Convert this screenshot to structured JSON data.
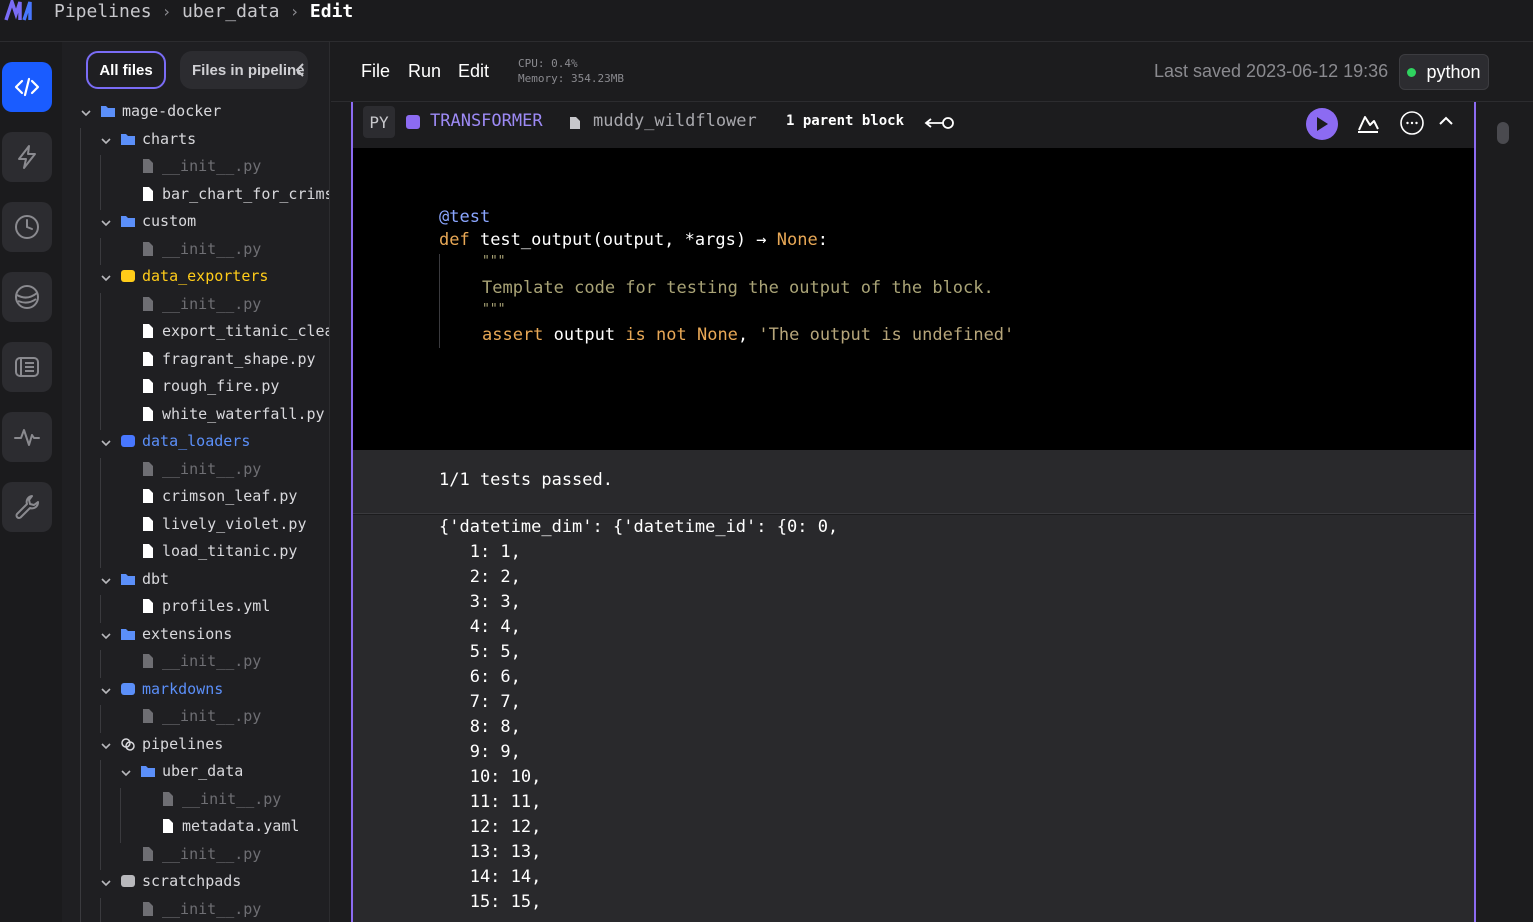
{
  "breadcrumb": {
    "root": "Pipelines",
    "pipeline": "uber_data",
    "current": "Edit"
  },
  "rail": {
    "items": [
      "code-icon",
      "trigger-icon",
      "history-icon",
      "terminal-icon",
      "files-icon",
      "monitor-icon",
      "settings-icon"
    ]
  },
  "browser": {
    "tab_all": "All files",
    "tab_pipeline": "Files in pipeline",
    "tree": [
      {
        "label": "mage-docker",
        "kind": "folder",
        "depth": 0
      },
      {
        "label": "charts",
        "kind": "folder",
        "depth": 1
      },
      {
        "label": "__init__.py",
        "kind": "file-dim",
        "depth": 2
      },
      {
        "label": "bar_chart_for_crimson",
        "kind": "file",
        "depth": 2
      },
      {
        "label": "custom",
        "kind": "folder",
        "depth": 1
      },
      {
        "label": "__init__.py",
        "kind": "file-dim",
        "depth": 2
      },
      {
        "label": "data_exporters",
        "kind": "exporter",
        "depth": 1
      },
      {
        "label": "__init__.py",
        "kind": "file-dim",
        "depth": 2
      },
      {
        "label": "export_titanic_clean",
        "kind": "file",
        "depth": 2
      },
      {
        "label": "fragrant_shape.py",
        "kind": "file",
        "depth": 2
      },
      {
        "label": "rough_fire.py",
        "kind": "file",
        "depth": 2
      },
      {
        "label": "white_waterfall.py",
        "kind": "file",
        "depth": 2
      },
      {
        "label": "data_loaders",
        "kind": "loader",
        "depth": 1
      },
      {
        "label": "__init__.py",
        "kind": "file-dim",
        "depth": 2
      },
      {
        "label": "crimson_leaf.py",
        "kind": "file",
        "depth": 2
      },
      {
        "label": "lively_violet.py",
        "kind": "file",
        "depth": 2
      },
      {
        "label": "load_titanic.py",
        "kind": "file",
        "depth": 2
      },
      {
        "label": "dbt",
        "kind": "folder",
        "depth": 1
      },
      {
        "label": "profiles.yml",
        "kind": "file",
        "depth": 2
      },
      {
        "label": "extensions",
        "kind": "folder",
        "depth": 1
      },
      {
        "label": "__init__.py",
        "kind": "file-dim",
        "depth": 2
      },
      {
        "label": "markdowns",
        "kind": "markdown",
        "depth": 1
      },
      {
        "label": "__init__.py",
        "kind": "file-dim",
        "depth": 2
      },
      {
        "label": "pipelines",
        "kind": "pipelines",
        "depth": 1
      },
      {
        "label": "uber_data",
        "kind": "folder",
        "depth": 2
      },
      {
        "label": "__init__.py",
        "kind": "file-dim",
        "depth": 3
      },
      {
        "label": "metadata.yaml",
        "kind": "file",
        "depth": 3
      },
      {
        "label": "__init__.py",
        "kind": "file-dim",
        "depth": 2
      },
      {
        "label": "scratchpads",
        "kind": "scratchpad",
        "depth": 1
      },
      {
        "label": "__init__.py",
        "kind": "file-dim",
        "depth": 2
      }
    ]
  },
  "toolbar": {
    "menu_file": "File",
    "menu_run": "Run",
    "menu_edit": "Edit",
    "cpu": "CPU: 0.4%",
    "memory": "Memory: 354.23MB",
    "saved": "Last saved 2023-06-12 19:36",
    "kernel": "python"
  },
  "block": {
    "lang": "PY",
    "type": "TRANSFORMER",
    "name": "muddy_wildflower",
    "parents": "1 parent block",
    "colors": {
      "transformer": "#8c6bf2",
      "accent": "#1a5cff",
      "exporter": "#ffcc19",
      "loader": "#4877ff"
    }
  },
  "code": {
    "l1": "@test",
    "l2_def": "def",
    "l2_sig": " test_output(output, *args) → ",
    "l2_none": "None",
    "l2_end": ":",
    "l3": "\"\"\"",
    "l4": "Template code for testing the output of the block.",
    "l5": "\"\"\"",
    "l6_assert": "assert",
    "l6_output": " output ",
    "l6_isnot": "is not",
    "l6_none": " None",
    "l6_comma": ", ",
    "l6_msg": "'The output is undefined'"
  },
  "result": {
    "tests": "1/1 tests passed.",
    "lines": [
      "{'datetime_dim': {'datetime_id': {0: 0,",
      "   1: 1,",
      "   2: 2,",
      "   3: 3,",
      "   4: 4,",
      "   5: 5,",
      "   6: 6,",
      "   7: 7,",
      "   8: 8,",
      "   9: 9,",
      "   10: 10,",
      "   11: 11,",
      "   12: 12,",
      "   13: 13,",
      "   14: 14,",
      "   15: 15,"
    ]
  }
}
